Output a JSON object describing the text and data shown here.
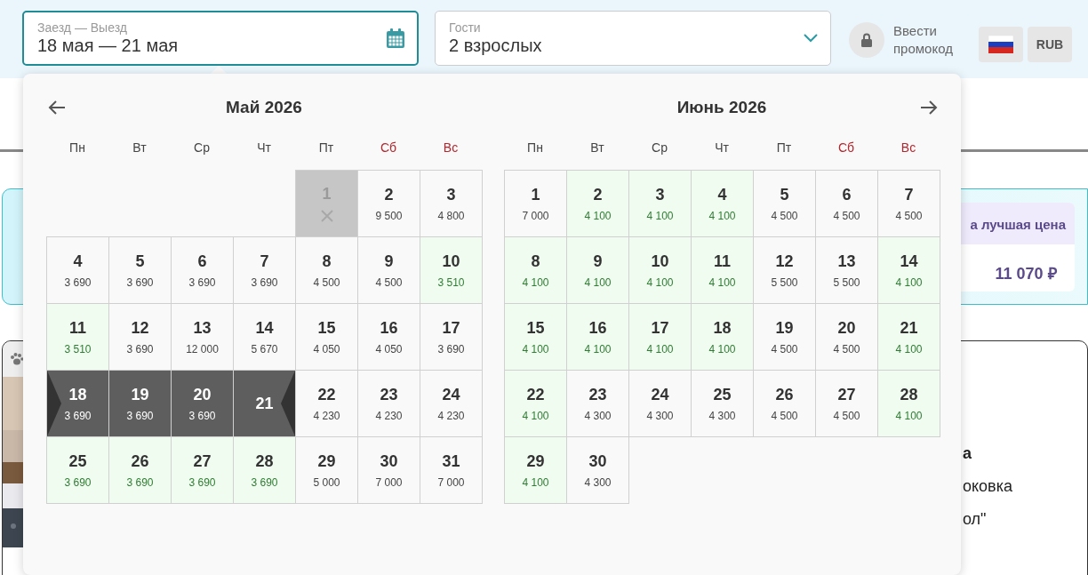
{
  "search": {
    "dates": {
      "label": "Заезд — Выезд",
      "value": "18 мая — 21 мая"
    },
    "guests": {
      "label": "Гости",
      "value": "2 взрослых"
    },
    "promo": "Ввести промокод",
    "currency": "RUB"
  },
  "page": {
    "banner": {
      "offer_title": "а лучшая цена",
      "offer_price": "11 070 ₽"
    },
    "card": {
      "texts": [
        "а",
        "оковка",
        "ол\""
      ]
    }
  },
  "calendar": {
    "months": [
      {
        "title": "Май 2026",
        "weekdays": [
          {
            "label": "Пн",
            "weekend": false
          },
          {
            "label": "Вт",
            "weekend": false
          },
          {
            "label": "Ср",
            "weekend": false
          },
          {
            "label": "Чт",
            "weekend": false
          },
          {
            "label": "Пт",
            "weekend": false
          },
          {
            "label": "Сб",
            "weekend": true
          },
          {
            "label": "Вс",
            "weekend": true
          }
        ],
        "days": [
          {
            "kind": "blank"
          },
          {
            "kind": "blank"
          },
          {
            "kind": "blank"
          },
          {
            "kind": "blank"
          },
          {
            "kind": "unavailable",
            "day": "1"
          },
          {
            "kind": "regular",
            "day": "2",
            "price": "9 500"
          },
          {
            "kind": "regular",
            "day": "3",
            "price": "4 800"
          },
          {
            "kind": "regular",
            "day": "4",
            "price": "3 690"
          },
          {
            "kind": "regular",
            "day": "5",
            "price": "3 690"
          },
          {
            "kind": "regular",
            "day": "6",
            "price": "3 690"
          },
          {
            "kind": "regular",
            "day": "7",
            "price": "3 690"
          },
          {
            "kind": "regular",
            "day": "8",
            "price": "4 500"
          },
          {
            "kind": "regular",
            "day": "9",
            "price": "4 500"
          },
          {
            "kind": "low",
            "day": "10",
            "price": "3 510"
          },
          {
            "kind": "low",
            "day": "11",
            "price": "3 510"
          },
          {
            "kind": "regular",
            "day": "12",
            "price": "3 690"
          },
          {
            "kind": "regular",
            "day": "13",
            "price": "12 000"
          },
          {
            "kind": "regular",
            "day": "14",
            "price": "5 670"
          },
          {
            "kind": "regular",
            "day": "15",
            "price": "4 050"
          },
          {
            "kind": "regular",
            "day": "16",
            "price": "4 050"
          },
          {
            "kind": "regular",
            "day": "17",
            "price": "3 690"
          },
          {
            "kind": "range_start",
            "day": "18",
            "price": "3 690"
          },
          {
            "kind": "range",
            "day": "19",
            "price": "3 690"
          },
          {
            "kind": "range",
            "day": "20",
            "price": "3 690"
          },
          {
            "kind": "range_end",
            "day": "21"
          },
          {
            "kind": "regular",
            "day": "22",
            "price": "4 230"
          },
          {
            "kind": "regular",
            "day": "23",
            "price": "4 230"
          },
          {
            "kind": "regular",
            "day": "24",
            "price": "4 230"
          },
          {
            "kind": "low",
            "day": "25",
            "price": "3 690"
          },
          {
            "kind": "low",
            "day": "26",
            "price": "3 690"
          },
          {
            "kind": "low",
            "day": "27",
            "price": "3 690"
          },
          {
            "kind": "low",
            "day": "28",
            "price": "3 690"
          },
          {
            "kind": "regular",
            "day": "29",
            "price": "5 000"
          },
          {
            "kind": "regular",
            "day": "30",
            "price": "7 000"
          },
          {
            "kind": "regular",
            "day": "31",
            "price": "7 000"
          }
        ]
      },
      {
        "title": "Июнь 2026",
        "weekdays": [
          {
            "label": "Пн",
            "weekend": false
          },
          {
            "label": "Вт",
            "weekend": false
          },
          {
            "label": "Ср",
            "weekend": false
          },
          {
            "label": "Чт",
            "weekend": false
          },
          {
            "label": "Пт",
            "weekend": false
          },
          {
            "label": "Сб",
            "weekend": true
          },
          {
            "label": "Вс",
            "weekend": true
          }
        ],
        "days": [
          {
            "kind": "regular",
            "day": "1",
            "price": "7 000"
          },
          {
            "kind": "low",
            "day": "2",
            "price": "4 100"
          },
          {
            "kind": "low",
            "day": "3",
            "price": "4 100"
          },
          {
            "kind": "low",
            "day": "4",
            "price": "4 100"
          },
          {
            "kind": "regular",
            "day": "5",
            "price": "4 500"
          },
          {
            "kind": "regular",
            "day": "6",
            "price": "4 500"
          },
          {
            "kind": "regular",
            "day": "7",
            "price": "4 500"
          },
          {
            "kind": "low",
            "day": "8",
            "price": "4 100"
          },
          {
            "kind": "low",
            "day": "9",
            "price": "4 100"
          },
          {
            "kind": "low",
            "day": "10",
            "price": "4 100"
          },
          {
            "kind": "low",
            "day": "11",
            "price": "4 100"
          },
          {
            "kind": "regular",
            "day": "12",
            "price": "5 500"
          },
          {
            "kind": "regular",
            "day": "13",
            "price": "5 500"
          },
          {
            "kind": "low",
            "day": "14",
            "price": "4 100"
          },
          {
            "kind": "low",
            "day": "15",
            "price": "4 100"
          },
          {
            "kind": "low",
            "day": "16",
            "price": "4 100"
          },
          {
            "kind": "low",
            "day": "17",
            "price": "4 100"
          },
          {
            "kind": "low",
            "day": "18",
            "price": "4 100"
          },
          {
            "kind": "regular",
            "day": "19",
            "price": "4 500"
          },
          {
            "kind": "regular",
            "day": "20",
            "price": "4 500"
          },
          {
            "kind": "low",
            "day": "21",
            "price": "4 100"
          },
          {
            "kind": "low",
            "day": "22",
            "price": "4 100"
          },
          {
            "kind": "regular",
            "day": "23",
            "price": "4 300"
          },
          {
            "kind": "regular",
            "day": "24",
            "price": "4 300"
          },
          {
            "kind": "regular",
            "day": "25",
            "price": "4 300"
          },
          {
            "kind": "regular",
            "day": "26",
            "price": "4 500"
          },
          {
            "kind": "regular",
            "day": "27",
            "price": "4 500"
          },
          {
            "kind": "low",
            "day": "28",
            "price": "4 100"
          },
          {
            "kind": "low",
            "day": "29",
            "price": "4 100"
          },
          {
            "kind": "regular",
            "day": "30",
            "price": "4 300"
          }
        ]
      }
    ]
  }
}
